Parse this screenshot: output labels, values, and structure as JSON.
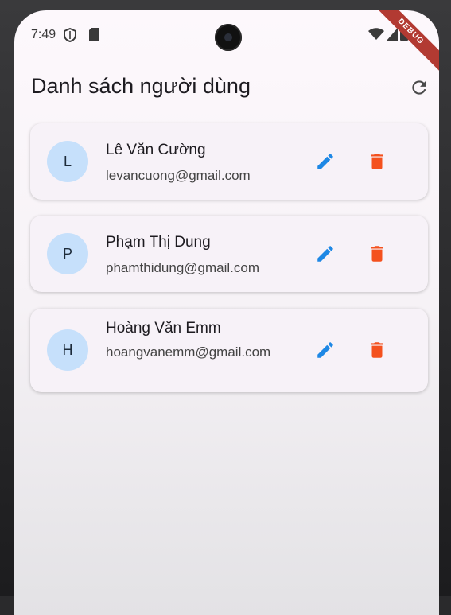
{
  "status_bar": {
    "time": "7:49",
    "debug_banner": "DEBUG"
  },
  "app_bar": {
    "title": "Danh sách người dùng",
    "refresh_icon": "refresh-icon"
  },
  "users": [
    {
      "initial": "L",
      "name": "Lê Văn Cường",
      "email": "levancuong@gmail.com"
    },
    {
      "initial": "P",
      "name": "Phạm Thị Dung",
      "email": "phamthidung@gmail.com"
    },
    {
      "initial": "H",
      "name": "Hoàng Văn Emm",
      "email": "hoangvanemm@gmail.com"
    }
  ],
  "icons": {
    "edit": "edit-icon",
    "delete": "delete-icon"
  },
  "colors": {
    "edit": "#1e88e5",
    "delete": "#f4511e",
    "avatar_bg": "#c6e0fb",
    "debug_banner": "#b23a32"
  }
}
